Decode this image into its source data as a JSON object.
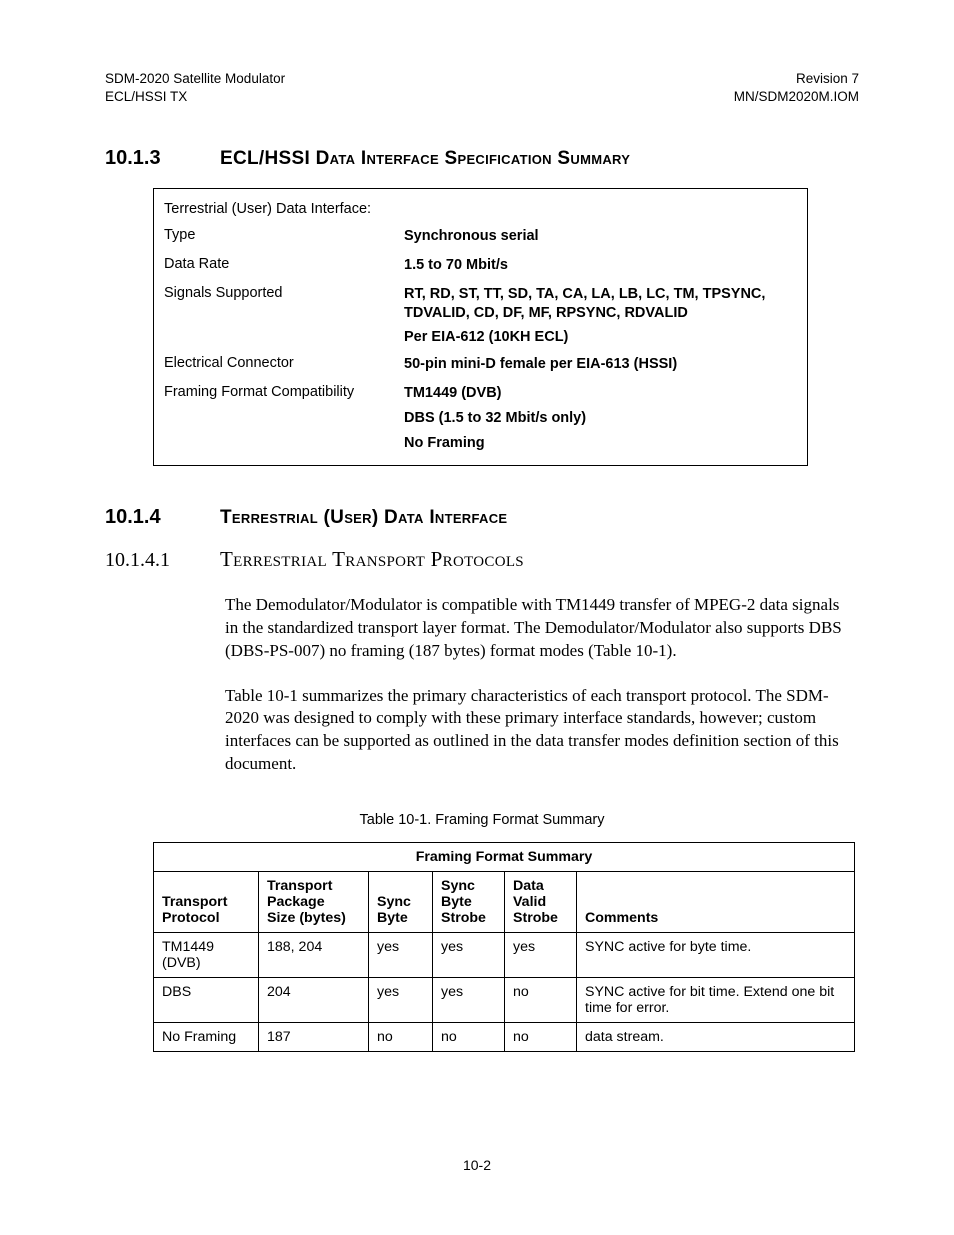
{
  "header": {
    "left1": "SDM-2020 Satellite Modulator",
    "left2": "ECL/HSSI TX",
    "right1": "Revision 7",
    "right2": "MN/SDM2020M.IOM"
  },
  "section_1013": {
    "num": "10.1.3",
    "title": "ECL/HSSI Data Interface Specification Summary"
  },
  "spec": {
    "r0_label": "Terrestrial (User) Data Interface:",
    "r1_label": "Type",
    "r1_value": "Synchronous serial",
    "r2_label": "Data Rate",
    "r2_value": "1.5 to 70 Mbit/s",
    "r3_label": "Signals Supported",
    "r3_value_a": "RT, RD, ST, TT, SD, TA, CA, LA, LB, LC, TM, TPSYNC, TDVALID, CD, DF, MF, RPSYNC, RDVALID",
    "r3_value_b": "Per EIA-612 (10KH ECL)",
    "r4_label": "Electrical Connector",
    "r4_value": "50-pin mini-D female per EIA-613 (HSSI)",
    "r5_label": "Framing Format Compatibility",
    "r5_value_a": "TM1449 (DVB)",
    "r5_value_b": "DBS (1.5 to 32 Mbit/s only)",
    "r5_value_c": "No Framing"
  },
  "section_1014": {
    "num": "10.1.4",
    "title": "Terrestrial (User) Data Interface"
  },
  "section_10141": {
    "num": "10.1.4.1",
    "title": "Terrestrial Transport Protocols"
  },
  "body": {
    "p1": "The Demodulator/Modulator is compatible with TM1449 transfer of MPEG-2 data signals in the standardized transport layer format. The Demodulator/Modulator also supports DBS (DBS-PS-007) no framing (187 bytes) format modes (Table 10-1).",
    "p2": "Table 10-1 summarizes the primary characteristics of each transport protocol. The SDM-2020 was designed to comply with these primary interface standards, however; custom interfaces can be supported as outlined in the data transfer modes definition section of this document."
  },
  "table_caption": "Table 10-1.  Framing Format Summary",
  "framing_table": {
    "title": "Framing Format Summary",
    "headers": {
      "c0": "Transport Protocol",
      "c1_a": "Transport Package",
      "c1_b": "Size (bytes)",
      "c2": "Sync Byte",
      "c3_a": "Sync Byte",
      "c3_b": "Strobe",
      "c4_a": "Data Valid",
      "c4_b": "Strobe",
      "c5": "Comments"
    },
    "rows": [
      {
        "c0": "TM1449 (DVB)",
        "c1": "188, 204",
        "c2": "yes",
        "c3": "yes",
        "c4": "yes",
        "c5": "SYNC active for byte time."
      },
      {
        "c0": "DBS",
        "c1": "204",
        "c2": "yes",
        "c3": "yes",
        "c4": "no",
        "c5": "SYNC active for bit time. Extend one bit time for error."
      },
      {
        "c0": "No Framing",
        "c1": "187",
        "c2": "no",
        "c3": "no",
        "c4": "no",
        "c5": "data stream."
      }
    ]
  },
  "page_number": "10-2"
}
